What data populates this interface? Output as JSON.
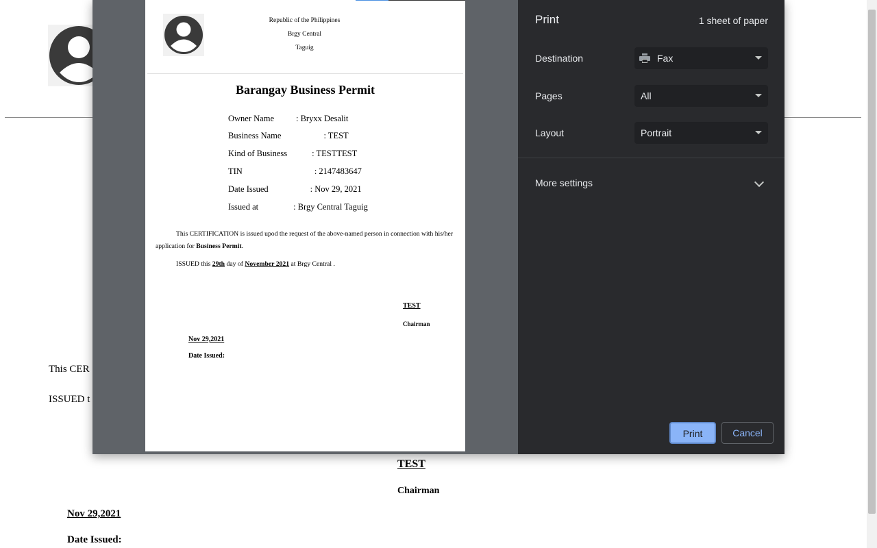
{
  "background_page": {
    "para1": "This CER",
    "para2": "ISSUED t",
    "signatory_name": "TEST",
    "signatory_title": "Chairman",
    "date": "Nov 29,2021",
    "date_label": "Date Issued:"
  },
  "preview": {
    "header_lines": [
      "Republic of the Philippines",
      "Brgy Central",
      "Taguig"
    ],
    "title": "Barangay Business Permit",
    "fields": [
      {
        "label": "Owner Name",
        "value": ": Bryxx Desalit"
      },
      {
        "label": "Business Name",
        "value": ": TEST"
      },
      {
        "label": "Kind of Business",
        "value": ": TESTTEST"
      },
      {
        "label": "TIN",
        "value": ": 2147483647"
      },
      {
        "label": "Date Issued",
        "value": ": Nov 29, 2021"
      },
      {
        "label": "Issued at",
        "value": ": Brgy Central Taguig"
      }
    ],
    "certification_pre": "This CERTIFICATION is issued upod the request of the above-named person in connection with his/her application for ",
    "certification_bold": "Business Permit",
    "certification_post": ".",
    "issued_pre": "ISSUED this ",
    "issued_day": "29th",
    "issued_mid": " day of ",
    "issued_month": "November 2021",
    "issued_post": " at Brgy Central .",
    "signatory_name": "TEST",
    "signatory_title": "Chairman",
    "date": "Nov 29,2021",
    "date_label": "Date Issued:"
  },
  "print_dialog": {
    "title": "Print",
    "sheet_count": "1 sheet of paper",
    "destination_label": "Destination",
    "destination_value": "Fax",
    "destination_icon": "printer-icon",
    "pages_label": "Pages",
    "pages_value": "All",
    "layout_label": "Layout",
    "layout_value": "Portrait",
    "more_settings_label": "More settings",
    "print_button": "Print",
    "cancel_button": "Cancel"
  },
  "colors": {
    "dialog_background": "#292a2d",
    "preview_background": "#5f6368",
    "accent": "#8ab4f8"
  }
}
